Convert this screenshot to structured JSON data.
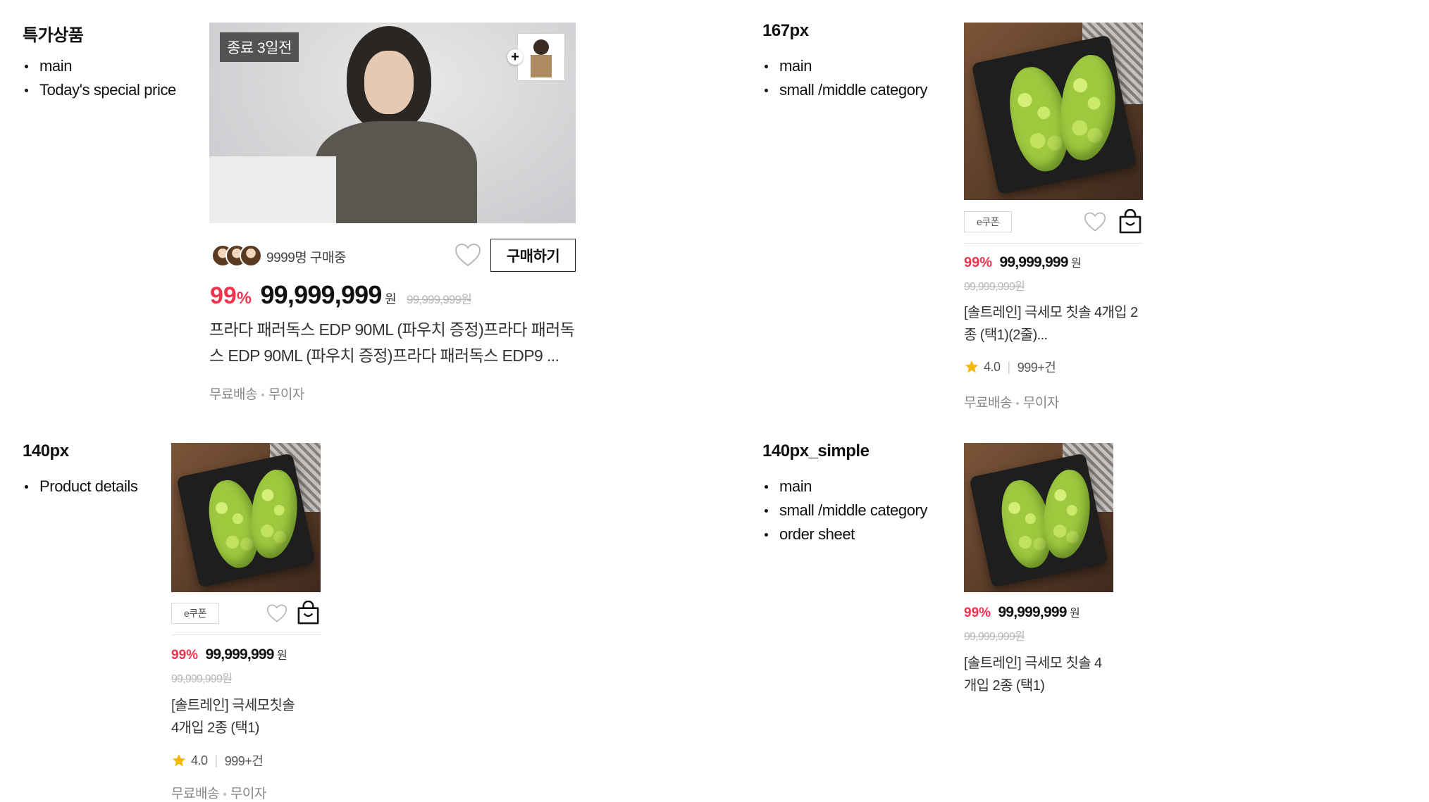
{
  "sections": {
    "special": {
      "title": "특가상품",
      "bullets": [
        "main",
        "Today's special price"
      ]
    },
    "px167": {
      "title": "167px",
      "bullets": [
        "main",
        "small /middle category"
      ]
    },
    "px140": {
      "title": "140px",
      "bullets": [
        "Product details"
      ]
    },
    "px140_simple": {
      "title": "140px_simple",
      "bullets": [
        "main",
        "small /middle category",
        "order sheet"
      ]
    }
  },
  "special_card": {
    "timer_badge": "종료 3일전",
    "buyers_text": "9999명 구매중",
    "buy_button": "구매하기",
    "discount": "99",
    "discount_unit": "%",
    "price": "99,999,999",
    "currency": "원",
    "original_price": "99,999,999원",
    "name": "프라다 패러독스 EDP 90ML (파우치 증정)프라다 패러독스 EDP 90ML (파우치 증정)프라다 패러독스 EDP9 ...",
    "shipping": "무료배송",
    "installment": "무이자",
    "icons": [
      "plus-icon",
      "heart-icon"
    ]
  },
  "card167": {
    "coupon": "e쿠폰",
    "discount": "99%",
    "price": "99,999,999",
    "currency": "원",
    "original_price": "99,999,999원",
    "name": "[솔트레인] 극세모 칫솔 4개입 2종 (택1)(2줄)...",
    "rating": "4.0",
    "review_count": "999+건",
    "shipping": "무료배송",
    "installment": "무이자",
    "icons": [
      "heart-icon",
      "cart-icon",
      "star-icon"
    ]
  },
  "card140": {
    "coupon": "e쿠폰",
    "discount": "99%",
    "price": "99,999,999",
    "currency": "원",
    "original_price": "99,999,999원",
    "name_line1": "[솔트레인] 극세모칫솔",
    "name_line2": "4개입 2종 (택1)",
    "rating": "4.0",
    "review_count": "999+건",
    "shipping": "무료배송",
    "installment": "무이자",
    "icons": [
      "heart-icon",
      "cart-icon",
      "star-icon"
    ]
  },
  "card140_simple": {
    "discount": "99%",
    "price": "99,999,999",
    "currency": "원",
    "original_price": "99,999,999원",
    "name_line1": "[솔트레인] 극세모 칫솔 4",
    "name_line2": "개입 2종 (택1)"
  },
  "colors": {
    "discount": "#f0344e",
    "text": "#111111",
    "muted": "#888888",
    "strike": "#b5b5b5",
    "star": "#f5b800"
  }
}
